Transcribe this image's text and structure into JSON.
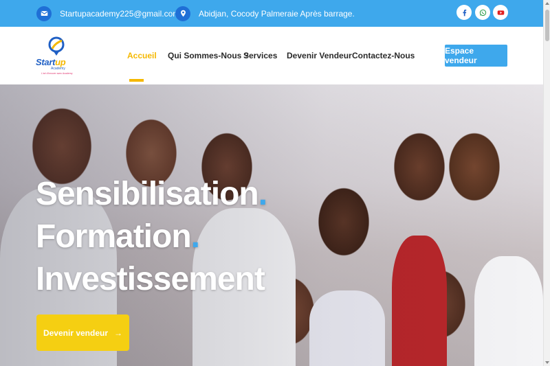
{
  "topbar": {
    "email": "Startupacademy225@gmail.com",
    "address": "Abidjan, Cocody Palmeraie Après barrage.",
    "email_icon": "envelope-icon",
    "address_icon": "map-pin-icon",
    "socials": [
      "facebook-icon",
      "whatsapp-icon",
      "youtube-icon"
    ]
  },
  "logo": {
    "start": "Start",
    "up": "up",
    "sub": "Academy",
    "tagline": "L'art d'innover avec Academy"
  },
  "nav": {
    "items": [
      "Accueil",
      "Qui Sommes-Nous ?",
      "Services",
      "Devenir Vendeur",
      "Contactez-Nous"
    ],
    "active": "Accueil",
    "cta": "Espace vendeur"
  },
  "hero": {
    "lines": [
      "Sensibilisation",
      "Formation",
      "Investissement"
    ],
    "dot": ".",
    "button": "Devenir vendeur",
    "button_icon": "arrow-right-icon"
  },
  "colors": {
    "topbar": "#3ea8ec",
    "accent": "#f5b800",
    "button": "#f5cf12",
    "brand_blue": "#1f5fc4"
  }
}
